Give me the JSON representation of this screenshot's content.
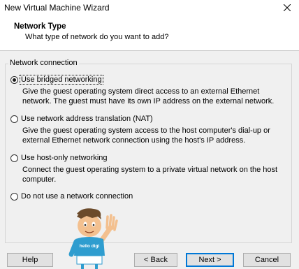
{
  "window": {
    "title": "New Virtual Machine Wizard"
  },
  "header": {
    "title": "Network Type",
    "subtitle": "What type of network do you want to add?"
  },
  "group": {
    "label": "Network connection",
    "options": [
      {
        "label": "Use bridged networking",
        "checked": true,
        "desc": "Give the guest operating system direct access to an external Ethernet network. The guest must have its own IP address on the external network."
      },
      {
        "label": "Use network address translation (NAT)",
        "checked": false,
        "desc": "Give the guest operating system access to the host computer's dial-up or external Ethernet network connection using the host's IP address."
      },
      {
        "label": "Use host-only networking",
        "checked": false,
        "desc": "Connect the guest operating system to a private virtual network on the host computer."
      },
      {
        "label": "Do not use a network connection",
        "checked": false,
        "desc": ""
      }
    ]
  },
  "mascot": {
    "text": "hello digi"
  },
  "buttons": {
    "help": "Help",
    "back": "< Back",
    "next": "Next >",
    "cancel": "Cancel"
  }
}
